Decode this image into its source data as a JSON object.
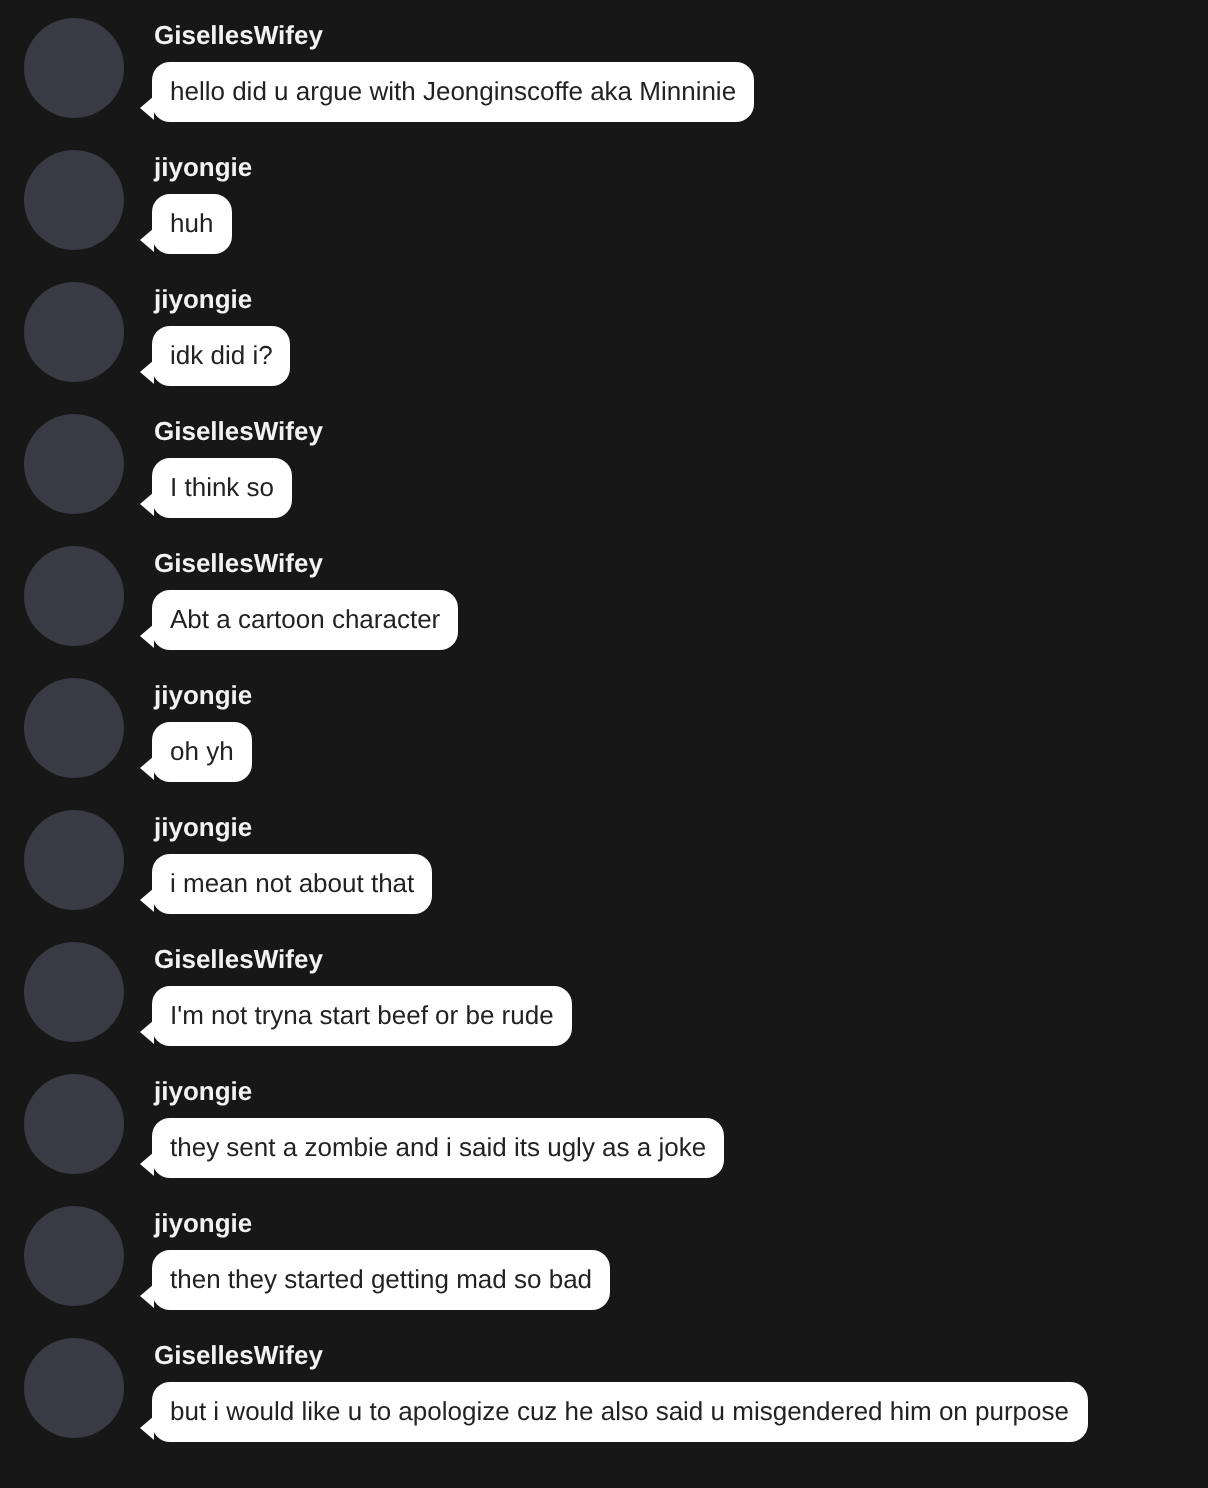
{
  "messages": [
    {
      "sender": "GisellesWifey",
      "text": "hello did u argue with Jeonginscoffe aka Minninie"
    },
    {
      "sender": "jiyongie",
      "text": "huh"
    },
    {
      "sender": "jiyongie",
      "text": "idk did i?"
    },
    {
      "sender": "GisellesWifey",
      "text": "I think so"
    },
    {
      "sender": "GisellesWifey",
      "text": "Abt a cartoon character"
    },
    {
      "sender": "jiyongie",
      "text": "oh yh"
    },
    {
      "sender": "jiyongie",
      "text": "i mean not about that"
    },
    {
      "sender": "GisellesWifey",
      "text": "I'm not tryna start beef or be rude"
    },
    {
      "sender": "jiyongie",
      "text": "they sent a zombie and i said its ugly as a joke"
    },
    {
      "sender": "jiyongie",
      "text": "then they started getting mad so bad"
    },
    {
      "sender": "GisellesWifey",
      "text": "but i would like u to apologize cuz he also said u misgendered him on purpose"
    }
  ]
}
